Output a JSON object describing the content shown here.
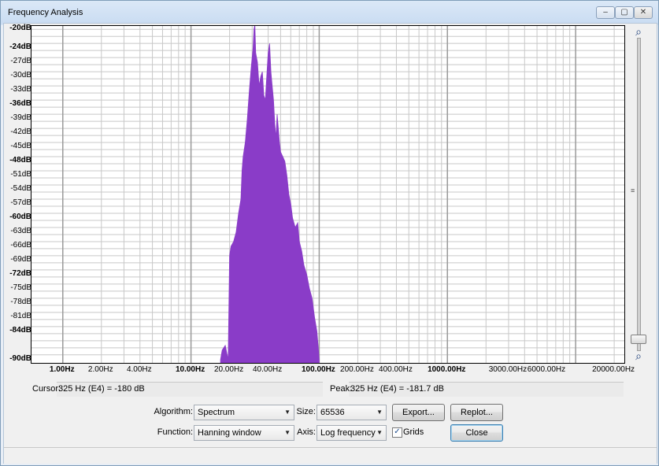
{
  "window": {
    "title": "Frequency Analysis",
    "minimize_glyph": "–",
    "restore_glyph": "▢",
    "close_glyph": "✕"
  },
  "plot": {
    "fill_color": "#8a3cc8",
    "y_labels": [
      {
        "text": "-20dB",
        "db": -20,
        "major": true
      },
      {
        "text": "-24dB",
        "db": -24,
        "major": true
      },
      {
        "text": "-27dB",
        "db": -27,
        "major": false
      },
      {
        "text": "-30dB",
        "db": -30,
        "major": false
      },
      {
        "text": "-33dB",
        "db": -33,
        "major": false
      },
      {
        "text": "-36dB",
        "db": -36,
        "major": true
      },
      {
        "text": "-39dB",
        "db": -39,
        "major": false
      },
      {
        "text": "-42dB",
        "db": -42,
        "major": false
      },
      {
        "text": "-45dB",
        "db": -45,
        "major": false
      },
      {
        "text": "-48dB",
        "db": -48,
        "major": true
      },
      {
        "text": "-51dB",
        "db": -51,
        "major": false
      },
      {
        "text": "-54dB",
        "db": -54,
        "major": false
      },
      {
        "text": "-57dB",
        "db": -57,
        "major": false
      },
      {
        "text": "-60dB",
        "db": -60,
        "major": true
      },
      {
        "text": "-63dB",
        "db": -63,
        "major": false
      },
      {
        "text": "-66dB",
        "db": -66,
        "major": false
      },
      {
        "text": "-69dB",
        "db": -69,
        "major": false
      },
      {
        "text": "-72dB",
        "db": -72,
        "major": true
      },
      {
        "text": "-75dB",
        "db": -75,
        "major": false
      },
      {
        "text": "-78dB",
        "db": -78,
        "major": false
      },
      {
        "text": "-81dB",
        "db": -81,
        "major": false
      },
      {
        "text": "-84dB",
        "db": -84,
        "major": true
      },
      {
        "text": "-90dB",
        "db": -90,
        "major": true
      }
    ],
    "x_labels": [
      {
        "text": "1.00Hz",
        "hz": 1,
        "major": true
      },
      {
        "text": "2.00Hz",
        "hz": 2,
        "major": false
      },
      {
        "text": "4.00Hz",
        "hz": 4,
        "major": false
      },
      {
        "text": "10.00Hz",
        "hz": 10,
        "major": true
      },
      {
        "text": "20.00Hz",
        "hz": 20,
        "major": false
      },
      {
        "text": "40.00Hz",
        "hz": 40,
        "major": false
      },
      {
        "text": "100.00Hz",
        "hz": 100,
        "major": true
      },
      {
        "text": "200.00Hz",
        "hz": 200,
        "major": false
      },
      {
        "text": "400.00Hz",
        "hz": 400,
        "major": false
      },
      {
        "text": "1000.00Hz",
        "hz": 1000,
        "major": true
      },
      {
        "text": "3000.00Hz",
        "hz": 3000,
        "major": false
      },
      {
        "text": "6000.00Hz",
        "hz": 6000,
        "major": false
      },
      {
        "text": "20000.00Hz",
        "hz": 20000,
        "major": false
      }
    ],
    "spectrum": [
      [
        17,
        -90
      ],
      [
        17.5,
        -88
      ],
      [
        18.5,
        -87
      ],
      [
        19.5,
        -90
      ],
      [
        20,
        -68
      ],
      [
        20.5,
        -66
      ],
      [
        21.5,
        -65
      ],
      [
        22.5,
        -63
      ],
      [
        23.5,
        -59
      ],
      [
        24.5,
        -56
      ],
      [
        25,
        -50
      ],
      [
        25.5,
        -47
      ],
      [
        26.5,
        -44
      ],
      [
        27.5,
        -39
      ],
      [
        28.5,
        -33
      ],
      [
        29.5,
        -28
      ],
      [
        30.5,
        -24
      ],
      [
        31,
        -20
      ],
      [
        31.5,
        -19
      ],
      [
        32,
        -25
      ],
      [
        33,
        -27
      ],
      [
        34,
        -32
      ],
      [
        35,
        -30
      ],
      [
        36,
        -29
      ],
      [
        37,
        -34
      ],
      [
        38,
        -35
      ],
      [
        39,
        -30
      ],
      [
        40,
        -25
      ],
      [
        41,
        -23
      ],
      [
        42,
        -29
      ],
      [
        43,
        -32
      ],
      [
        44,
        -35
      ],
      [
        45,
        -40
      ],
      [
        46,
        -43
      ],
      [
        47,
        -38
      ],
      [
        48,
        -41
      ],
      [
        49,
        -44
      ],
      [
        50,
        -46
      ],
      [
        52,
        -47
      ],
      [
        54,
        -48
      ],
      [
        56,
        -51
      ],
      [
        58,
        -55
      ],
      [
        60,
        -57
      ],
      [
        62,
        -60
      ],
      [
        65,
        -62
      ],
      [
        68,
        -61
      ],
      [
        70,
        -65
      ],
      [
        73,
        -67
      ],
      [
        76,
        -70
      ],
      [
        80,
        -72
      ],
      [
        84,
        -75
      ],
      [
        88,
        -77
      ],
      [
        92,
        -81
      ],
      [
        96,
        -84
      ],
      [
        98,
        -87
      ],
      [
        100,
        -90
      ]
    ]
  },
  "status": {
    "cursor_label": "Cursor:",
    "cursor_value": "325 Hz (E4) = -180 dB",
    "peak_label": "Peak:",
    "peak_value": "325 Hz (E4) = -181.7 dB"
  },
  "controls": {
    "algorithm_label": "Algorithm:",
    "algorithm_value": "Spectrum",
    "size_label": "Size:",
    "size_value": "65536",
    "export_label": "Export...",
    "replot_label": "Replot...",
    "function_label": "Function:",
    "function_value": "Hanning window",
    "axis_label": "Axis:",
    "axis_value": "Log frequency",
    "grids_label": "Grids",
    "grids_checked": true,
    "close_label": "Close"
  }
}
